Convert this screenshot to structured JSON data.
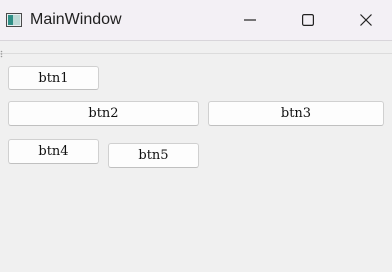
{
  "window": {
    "title": "MainWindow",
    "icons": {
      "app": "window-app-icon",
      "minimize": "minimize-icon",
      "maximize": "maximize-icon",
      "close": "close-icon",
      "grip": "toolbar-grip-icon"
    }
  },
  "buttons": {
    "btn1": "btn1",
    "btn2": "btn2",
    "btn3": "btn3",
    "btn4": "btn4",
    "btn5": "btn5"
  }
}
